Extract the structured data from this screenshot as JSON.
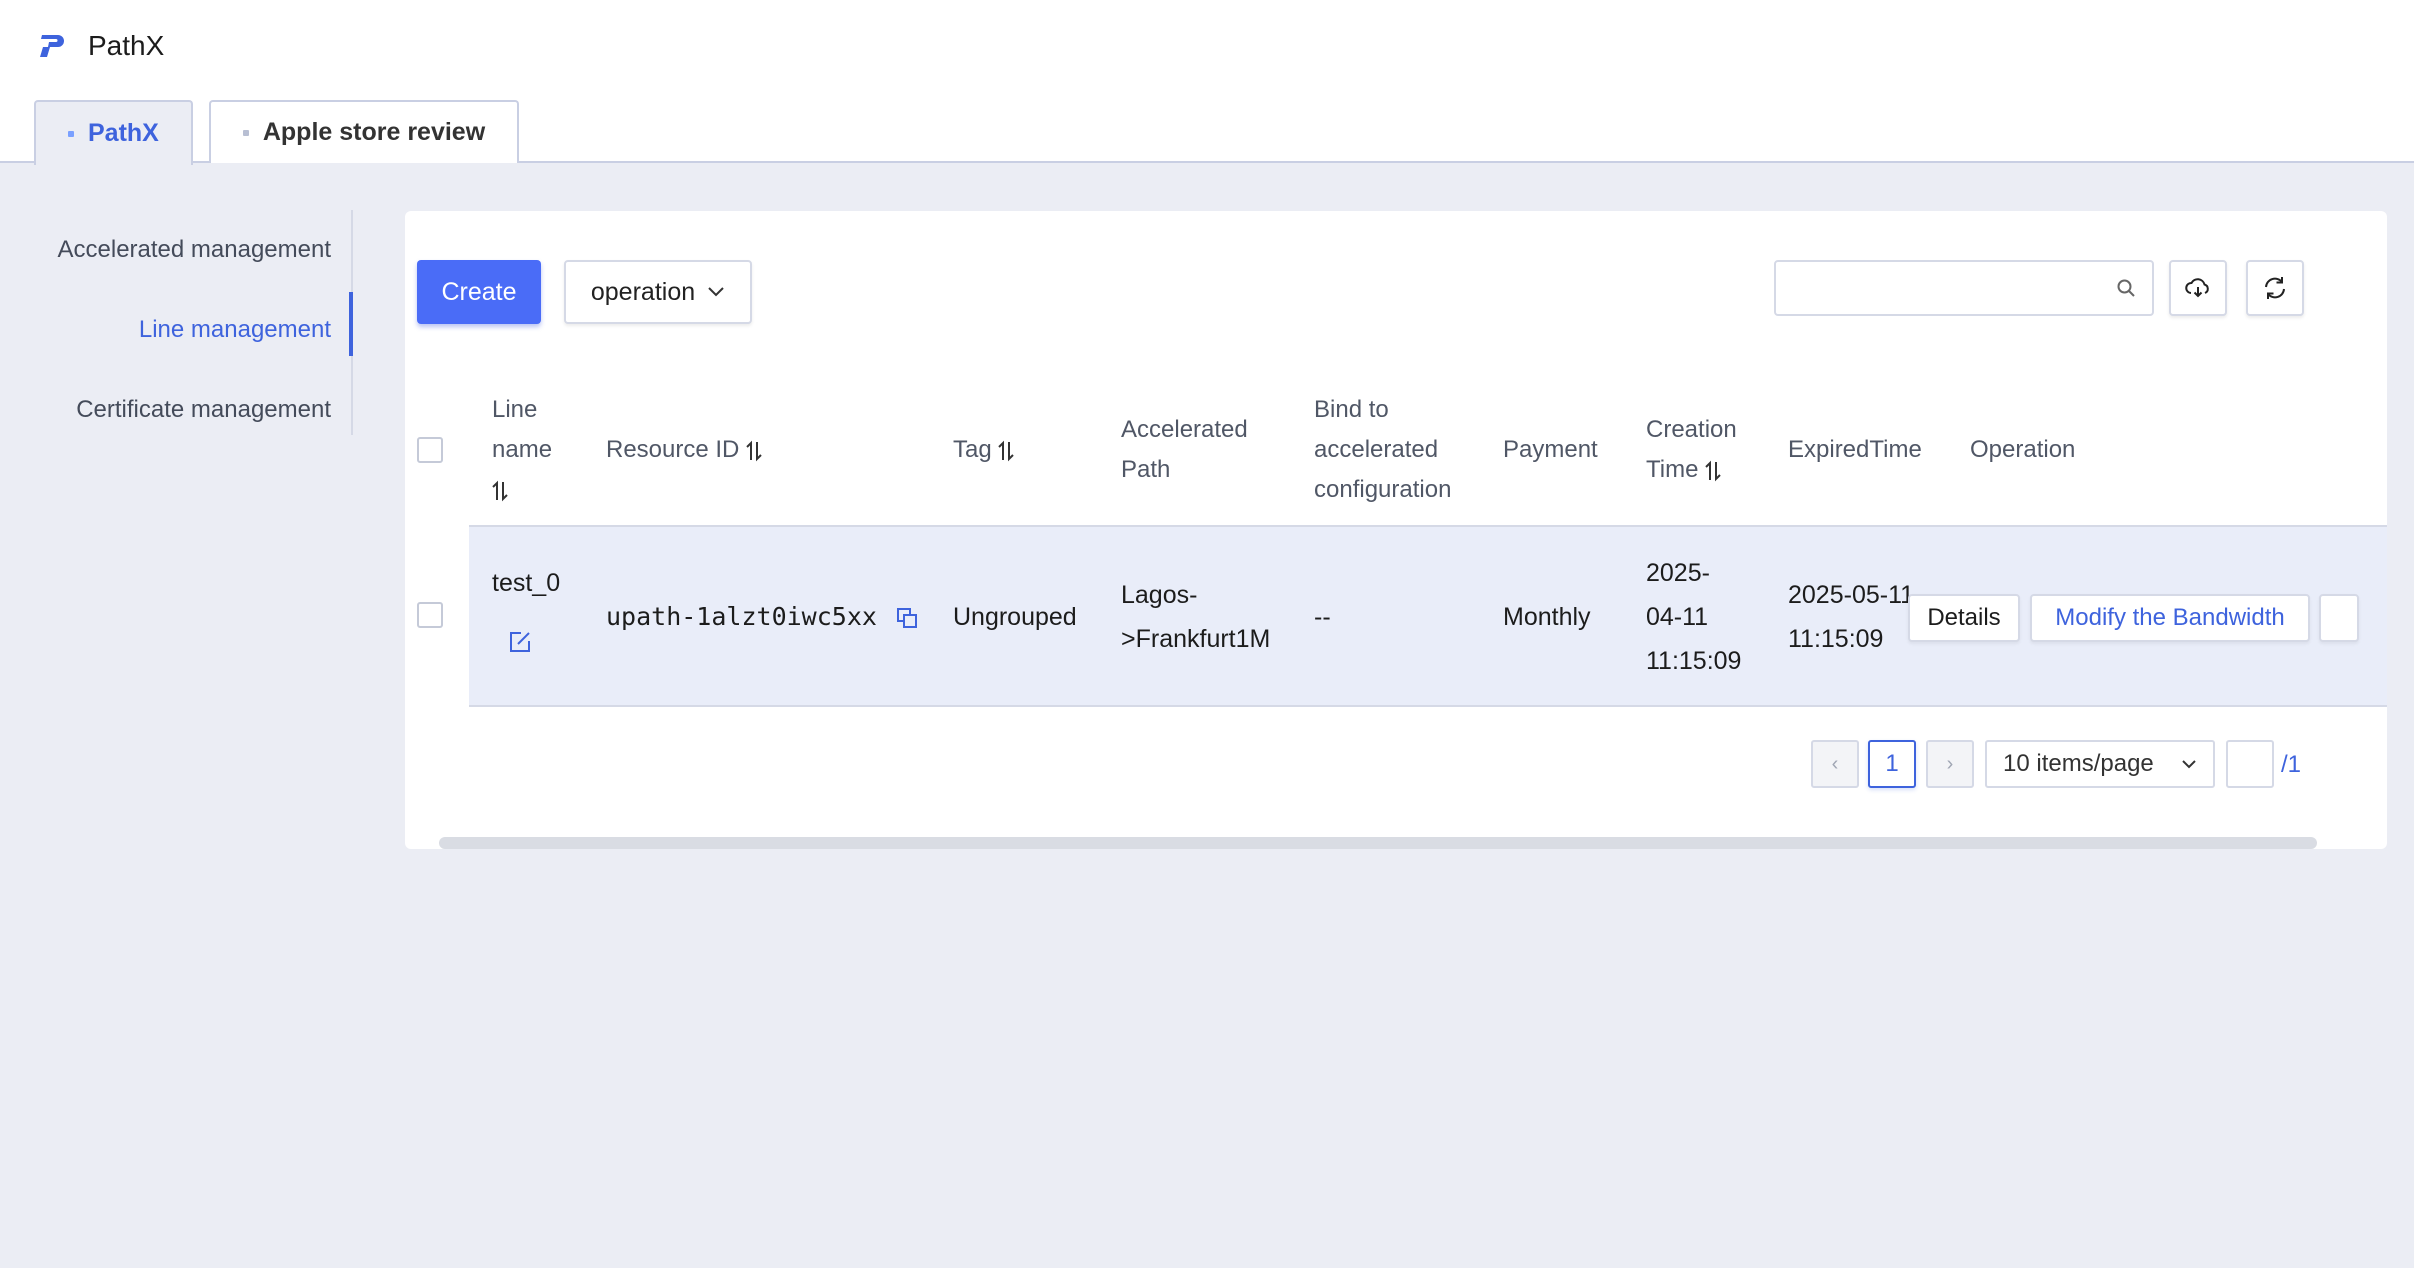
{
  "app": {
    "title": "PathX"
  },
  "tabs": [
    {
      "label": "PathX",
      "active": true
    },
    {
      "label": "Apple store review",
      "active": false
    }
  ],
  "sidebar": {
    "items": [
      {
        "label": "Accelerated management",
        "active": false
      },
      {
        "label": "Line management",
        "active": true
      },
      {
        "label": "Certificate management",
        "active": false
      }
    ]
  },
  "toolbar": {
    "create_label": "Create",
    "operation_label": "operation",
    "search_placeholder": ""
  },
  "table": {
    "headers": {
      "line_name_1": "Line",
      "line_name_2": "name",
      "resource_id": "Resource ID",
      "tag": "Tag",
      "accelerated_path_1": "Accelerated",
      "accelerated_path_2": "Path",
      "bind_1": "Bind to",
      "bind_2": "accelerated",
      "bind_3": "configuration",
      "payment": "Payment",
      "creation_time_1": "Creation",
      "creation_time_2": "Time",
      "expired_time": "ExpiredTime",
      "operation": "Operation"
    },
    "rows": [
      {
        "line_name": "test_0",
        "resource_id": "upath-1alzt0iwc5xx",
        "tag": "Ungrouped",
        "accelerated_path_1": "Lagos-",
        "accelerated_path_2": ">Frankfurt1M",
        "bind": "--",
        "payment": "Monthly",
        "creation_time_1": "2025-",
        "creation_time_2": "04-11",
        "creation_time_3": "11:15:09",
        "expired_time_1": "2025-05-11",
        "expired_time_2": "11:15:09",
        "details_label": "Details",
        "modify_label": "Modify the Bandwidth"
      }
    ]
  },
  "pagination": {
    "prev": "‹",
    "current": "1",
    "next": "›",
    "page_size": "10 items/page",
    "total": "/1"
  },
  "colors": {
    "accent": "#3e63dd",
    "primary_button": "#4a6cf7",
    "row_highlight": "#e9edf9",
    "page_bg": "#ebedf4"
  }
}
